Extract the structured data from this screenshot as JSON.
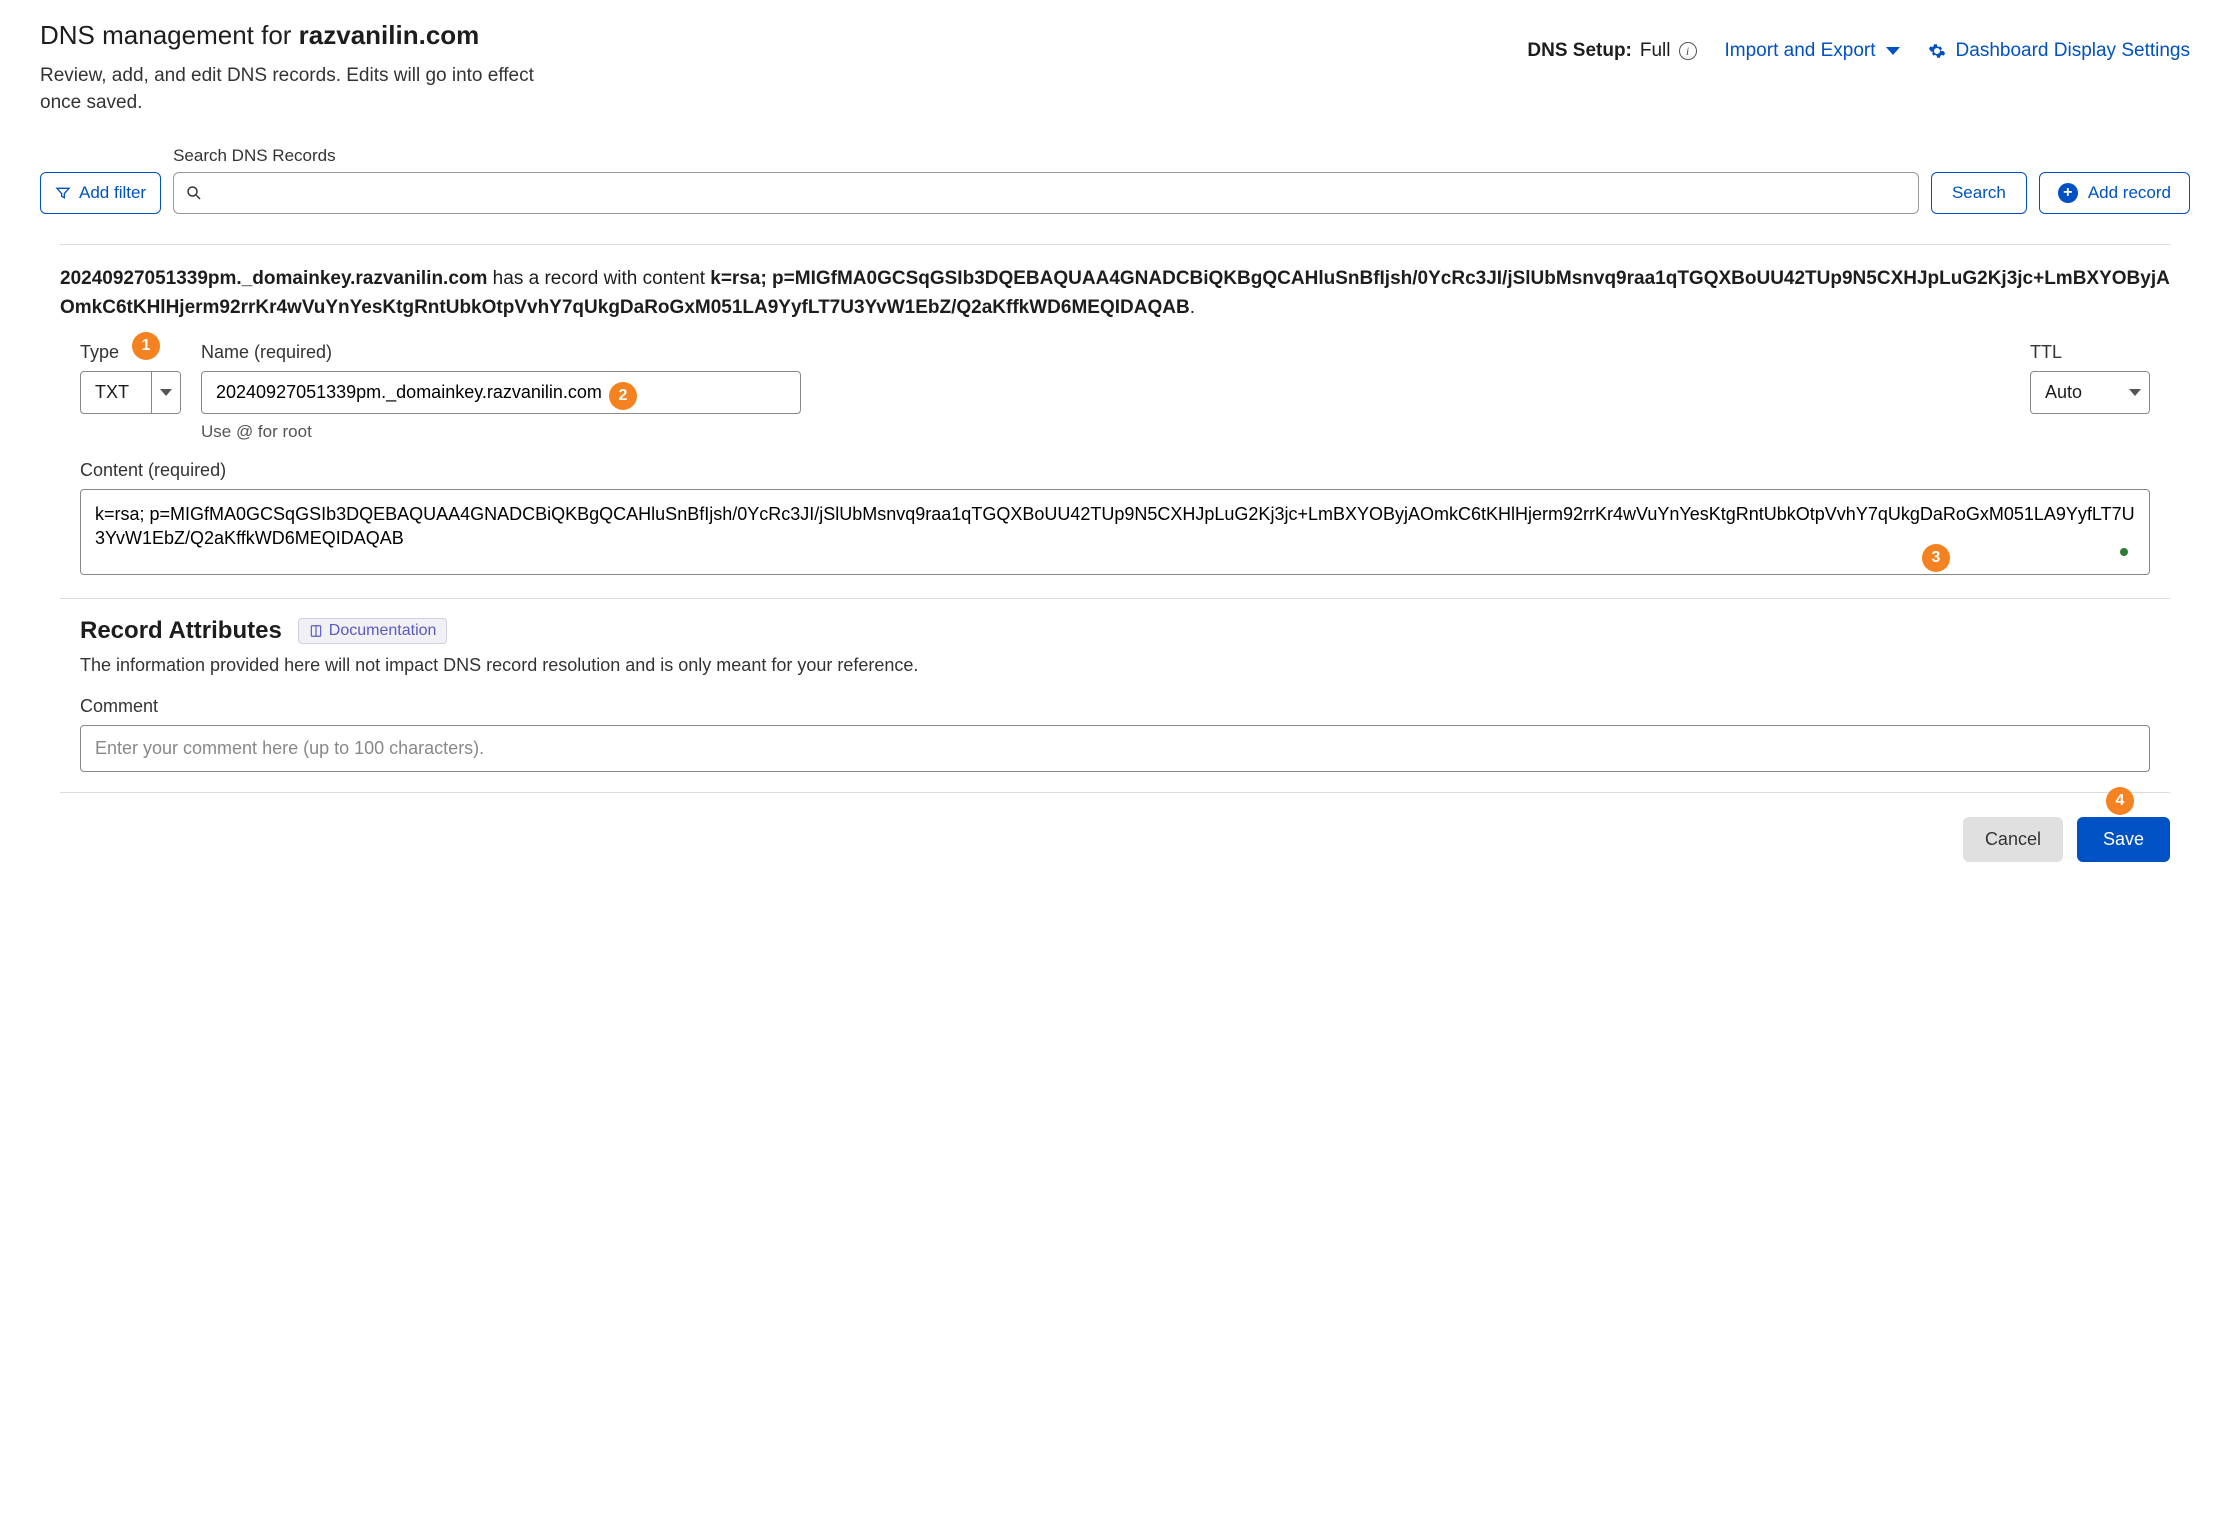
{
  "header": {
    "title_prefix": "DNS management for ",
    "domain": "razvanilin.com",
    "subtitle": "Review, add, and edit DNS records. Edits will go into effect once saved.",
    "dns_setup_label": "DNS Setup:",
    "dns_setup_value": "Full",
    "import_export": "Import and Export",
    "display_settings": "Dashboard Display Settings"
  },
  "toolbar": {
    "add_filter": "Add filter",
    "search_label": "Search DNS Records",
    "search_value": "",
    "search_button": "Search",
    "add_record": "Add record"
  },
  "record": {
    "summary_name": "20240927051339pm._domainkey.razvanilin.com",
    "summary_mid": " has a record with content ",
    "summary_content": "k=rsa; p=MIGfMA0GCSqGSIb3DQEBAQUAA4GNADCBiQKBgQCAHluSnBfIjsh/0YcRc3JI/jSlUbMsnvq9raa1qTGQXBoUU42TUp9N5CXHJpLuG2Kj3jc+LmBXYOByjAOmkC6tKHlHjerm92rrKr4wVuYnYesKtgRntUbkOtpVvhY7qUkgDaRoGxM051LA9YyfLT7U3YvW1EbZ/Q2aKffkWD6MEQIDAQAB",
    "type_label": "Type",
    "type_value": "TXT",
    "name_label": "Name (required)",
    "name_value": "20240927051339pm._domainkey.razvanilin.com",
    "name_hint": "Use @ for root",
    "ttl_label": "TTL",
    "ttl_value": "Auto",
    "content_label": "Content (required)",
    "content_value": "k=rsa; p=MIGfMA0GCSqGSIb3DQEBAQUAA4GNADCBiQKBgQCAHluSnBfIjsh/0YcRc3JI/jSlUbMsnvq9raa1qTGQXBoUU42TUp9N5CXHJpLuG2Kj3jc+LmBXYOByjAOmkC6tKHlHjerm92rrKr4wVuYnYesKtgRntUbkOtpVvhY7qUkgDaRoGxM051LA9YyfLT7U3YvW1EbZ/Q2aKffkWD6MEQIDAQAB"
  },
  "attributes": {
    "title": "Record Attributes",
    "documentation": "Documentation",
    "description": "The information provided here will not impact DNS record resolution and is only meant for your reference.",
    "comment_label": "Comment",
    "comment_placeholder": "Enter your comment here (up to 100 characters)."
  },
  "footer": {
    "cancel": "Cancel",
    "save": "Save"
  },
  "annotations": {
    "b1": "1",
    "b2": "2",
    "b3": "3",
    "b4": "4"
  }
}
